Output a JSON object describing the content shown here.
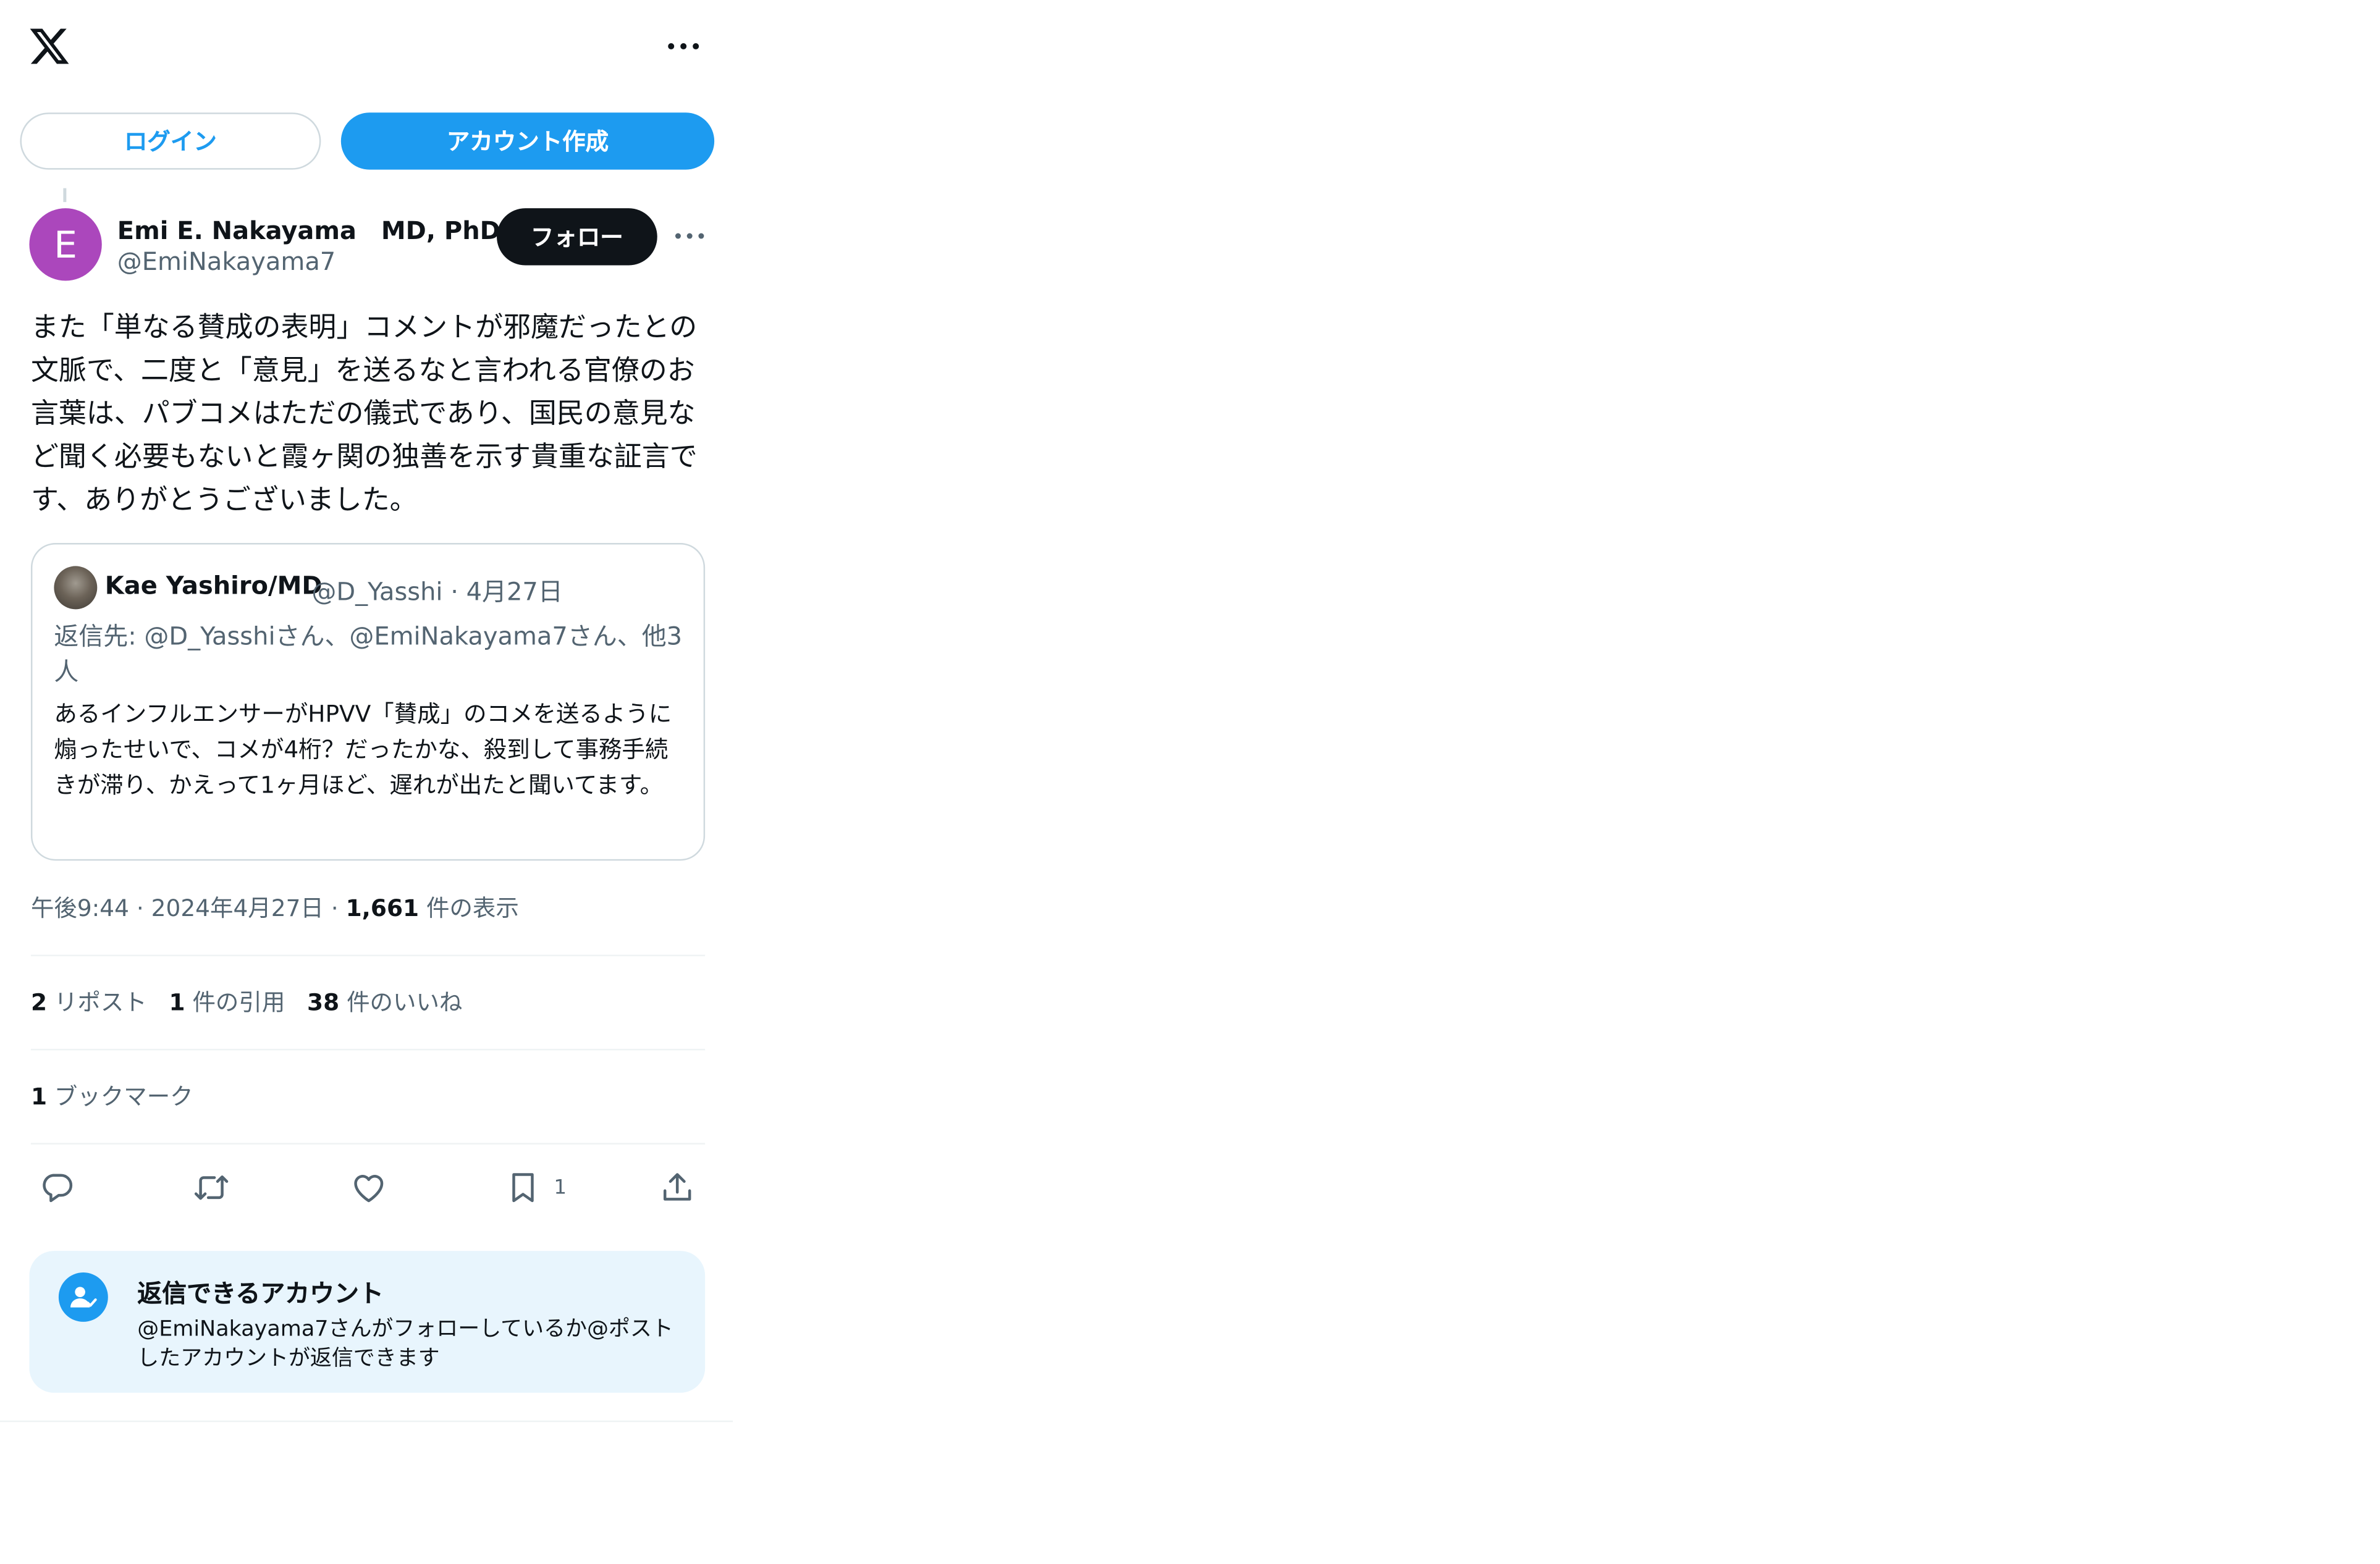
{
  "header": {
    "login_label": "ログイン",
    "signup_label": "アカウント作成"
  },
  "post": {
    "avatar_initial": "E",
    "author_name": "Emi E. Nakayama　MD, PhD",
    "author_handle": "@EmiNakayama7",
    "follow_label": "フォロー",
    "text": "また「単なる賛成の表明」コメントが邪魔だったとの文脈で、二度と「意見」を送るなと言われる官僚のお言葉は、パブコメはただの儀式であり、国民の意見など聞く必要もないと霞ヶ関の独善を示す貴重な証言です、ありがとうございました。",
    "quote": {
      "author_name": "Kae Yashiro/MD",
      "meta": "@D_Yasshi · 4月27日",
      "reply_to": "返信先: @D_Yasshiさん、@EmiNakayama7さん、他3人",
      "text": "あるインフルエンサーがHPVV「賛成」のコメを送るように煽ったせいで、コメが4桁？だったかな、殺到して事務手続きが滞り、かえって1ヶ月ほど、遅れが出たと聞いてます。"
    },
    "timestamp": "午後9:44 · 2024年4月27日 · ",
    "views_count": "1,661",
    "views_label": " 件の表示",
    "stats": {
      "reposts_count": "2",
      "reposts_label": " リポスト",
      "quotes_count": "1",
      "quotes_label": " 件の引用",
      "likes_count": "38",
      "likes_label": " 件のいいね",
      "bookmarks_count": "1",
      "bookmarks_label": " ブックマーク"
    },
    "actions": {
      "bookmark_count": "1"
    }
  },
  "reply_restriction": {
    "title": "返信できるアカウント",
    "text": "@EmiNakayama7さんがフォローしているか@ポストしたアカウントが返信できます"
  },
  "icons": [
    "x-logo-icon",
    "more-icon",
    "reply-icon",
    "repost-icon",
    "like-icon",
    "bookmark-icon",
    "share-icon",
    "user-check-icon"
  ],
  "colors": {
    "accent": "#1d9bf0",
    "text": "#0f1419",
    "secondary": "#536471",
    "avatar": "#ab47bc",
    "reply_box": "#e8f5fd"
  }
}
